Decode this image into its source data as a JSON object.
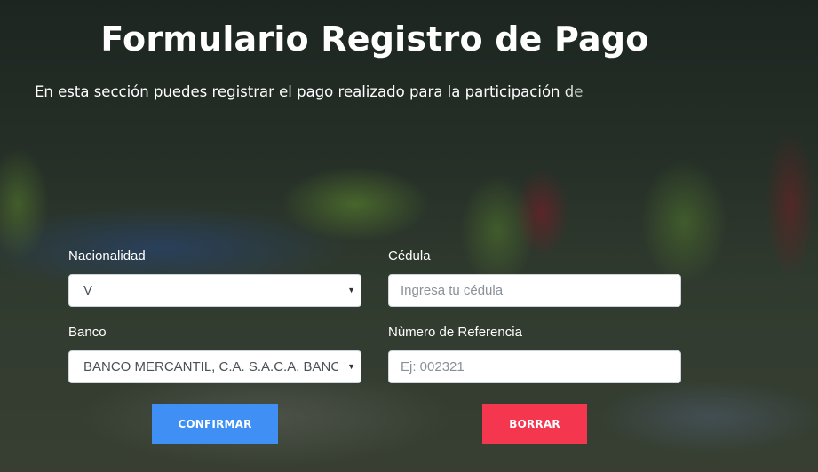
{
  "header": {
    "title": "Formulario Registro de Pago",
    "subtitle": "En esta sección puedes registrar el pago realizado para la participación de"
  },
  "form": {
    "nacionalidad": {
      "label": "Nacionalidad",
      "value": "V"
    },
    "cedula": {
      "label": "Cédula",
      "placeholder": "Ingresa tu cédula"
    },
    "banco": {
      "label": "Banco",
      "value": "BANCO MERCANTIL, C.A. S.A.C.A. BANCO UNIVERSAL"
    },
    "referencia": {
      "label": "Nùmero de Referencia",
      "placeholder": "Ej: 002321"
    }
  },
  "buttons": {
    "confirm_label": "CONFIRMAR",
    "reset_label": "BORRAR"
  },
  "colors": {
    "confirm": "#3f8ff5",
    "reset": "#f5364f",
    "text": "#ffffff"
  }
}
